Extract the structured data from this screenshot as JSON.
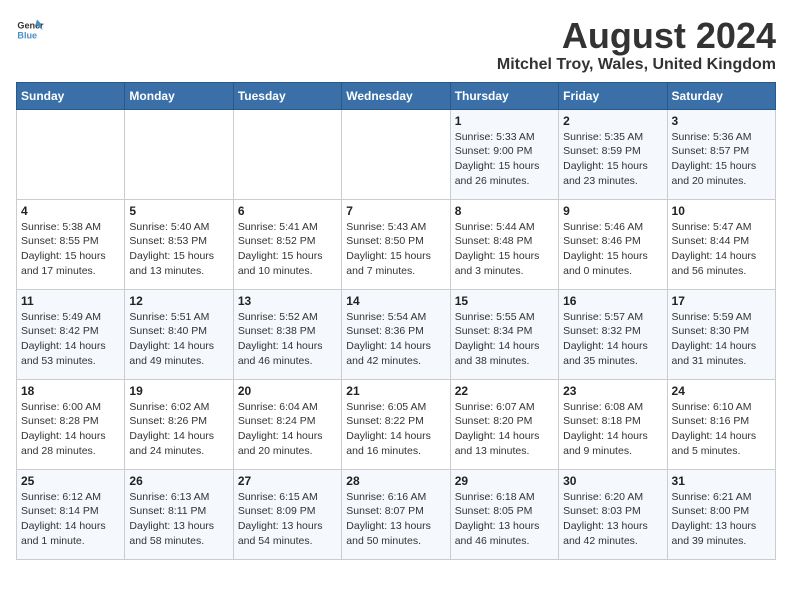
{
  "header": {
    "logo_line1": "General",
    "logo_line2": "Blue",
    "title": "August 2024",
    "subtitle": "Mitchel Troy, Wales, United Kingdom"
  },
  "days_of_week": [
    "Sunday",
    "Monday",
    "Tuesday",
    "Wednesday",
    "Thursday",
    "Friday",
    "Saturday"
  ],
  "weeks": [
    [
      {
        "day": "",
        "info": ""
      },
      {
        "day": "",
        "info": ""
      },
      {
        "day": "",
        "info": ""
      },
      {
        "day": "",
        "info": ""
      },
      {
        "day": "1",
        "info": "Sunrise: 5:33 AM\nSunset: 9:00 PM\nDaylight: 15 hours\nand 26 minutes."
      },
      {
        "day": "2",
        "info": "Sunrise: 5:35 AM\nSunset: 8:59 PM\nDaylight: 15 hours\nand 23 minutes."
      },
      {
        "day": "3",
        "info": "Sunrise: 5:36 AM\nSunset: 8:57 PM\nDaylight: 15 hours\nand 20 minutes."
      }
    ],
    [
      {
        "day": "4",
        "info": "Sunrise: 5:38 AM\nSunset: 8:55 PM\nDaylight: 15 hours\nand 17 minutes."
      },
      {
        "day": "5",
        "info": "Sunrise: 5:40 AM\nSunset: 8:53 PM\nDaylight: 15 hours\nand 13 minutes."
      },
      {
        "day": "6",
        "info": "Sunrise: 5:41 AM\nSunset: 8:52 PM\nDaylight: 15 hours\nand 10 minutes."
      },
      {
        "day": "7",
        "info": "Sunrise: 5:43 AM\nSunset: 8:50 PM\nDaylight: 15 hours\nand 7 minutes."
      },
      {
        "day": "8",
        "info": "Sunrise: 5:44 AM\nSunset: 8:48 PM\nDaylight: 15 hours\nand 3 minutes."
      },
      {
        "day": "9",
        "info": "Sunrise: 5:46 AM\nSunset: 8:46 PM\nDaylight: 15 hours\nand 0 minutes."
      },
      {
        "day": "10",
        "info": "Sunrise: 5:47 AM\nSunset: 8:44 PM\nDaylight: 14 hours\nand 56 minutes."
      }
    ],
    [
      {
        "day": "11",
        "info": "Sunrise: 5:49 AM\nSunset: 8:42 PM\nDaylight: 14 hours\nand 53 minutes."
      },
      {
        "day": "12",
        "info": "Sunrise: 5:51 AM\nSunset: 8:40 PM\nDaylight: 14 hours\nand 49 minutes."
      },
      {
        "day": "13",
        "info": "Sunrise: 5:52 AM\nSunset: 8:38 PM\nDaylight: 14 hours\nand 46 minutes."
      },
      {
        "day": "14",
        "info": "Sunrise: 5:54 AM\nSunset: 8:36 PM\nDaylight: 14 hours\nand 42 minutes."
      },
      {
        "day": "15",
        "info": "Sunrise: 5:55 AM\nSunset: 8:34 PM\nDaylight: 14 hours\nand 38 minutes."
      },
      {
        "day": "16",
        "info": "Sunrise: 5:57 AM\nSunset: 8:32 PM\nDaylight: 14 hours\nand 35 minutes."
      },
      {
        "day": "17",
        "info": "Sunrise: 5:59 AM\nSunset: 8:30 PM\nDaylight: 14 hours\nand 31 minutes."
      }
    ],
    [
      {
        "day": "18",
        "info": "Sunrise: 6:00 AM\nSunset: 8:28 PM\nDaylight: 14 hours\nand 28 minutes."
      },
      {
        "day": "19",
        "info": "Sunrise: 6:02 AM\nSunset: 8:26 PM\nDaylight: 14 hours\nand 24 minutes."
      },
      {
        "day": "20",
        "info": "Sunrise: 6:04 AM\nSunset: 8:24 PM\nDaylight: 14 hours\nand 20 minutes."
      },
      {
        "day": "21",
        "info": "Sunrise: 6:05 AM\nSunset: 8:22 PM\nDaylight: 14 hours\nand 16 minutes."
      },
      {
        "day": "22",
        "info": "Sunrise: 6:07 AM\nSunset: 8:20 PM\nDaylight: 14 hours\nand 13 minutes."
      },
      {
        "day": "23",
        "info": "Sunrise: 6:08 AM\nSunset: 8:18 PM\nDaylight: 14 hours\nand 9 minutes."
      },
      {
        "day": "24",
        "info": "Sunrise: 6:10 AM\nSunset: 8:16 PM\nDaylight: 14 hours\nand 5 minutes."
      }
    ],
    [
      {
        "day": "25",
        "info": "Sunrise: 6:12 AM\nSunset: 8:14 PM\nDaylight: 14 hours\nand 1 minute."
      },
      {
        "day": "26",
        "info": "Sunrise: 6:13 AM\nSunset: 8:11 PM\nDaylight: 13 hours\nand 58 minutes."
      },
      {
        "day": "27",
        "info": "Sunrise: 6:15 AM\nSunset: 8:09 PM\nDaylight: 13 hours\nand 54 minutes."
      },
      {
        "day": "28",
        "info": "Sunrise: 6:16 AM\nSunset: 8:07 PM\nDaylight: 13 hours\nand 50 minutes."
      },
      {
        "day": "29",
        "info": "Sunrise: 6:18 AM\nSunset: 8:05 PM\nDaylight: 13 hours\nand 46 minutes."
      },
      {
        "day": "30",
        "info": "Sunrise: 6:20 AM\nSunset: 8:03 PM\nDaylight: 13 hours\nand 42 minutes."
      },
      {
        "day": "31",
        "info": "Sunrise: 6:21 AM\nSunset: 8:00 PM\nDaylight: 13 hours\nand 39 minutes."
      }
    ]
  ]
}
